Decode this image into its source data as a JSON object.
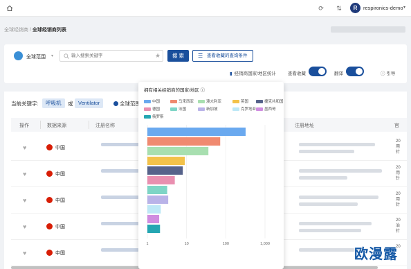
{
  "topbar": {
    "username": "respironics-demo",
    "avatar_letter": "R"
  },
  "breadcrumb": {
    "parent": "全球经销商",
    "separator": "/",
    "current": "全球经销商列表"
  },
  "search": {
    "scope_label": "全球范围",
    "placeholder": "输入搜索关键字",
    "search_button": "搜 索",
    "saved_button": "查看收藏的查询条件",
    "stats_link": "经销商国家/地区统计",
    "favorites_label": "查看收藏",
    "translate_label": "翻译",
    "guide_label": "引导"
  },
  "filters": {
    "prefix": "当前关键字:",
    "kw1": "呼吸机",
    "or": "或",
    "kw2": "Ventilator",
    "scope": "全球范围"
  },
  "table": {
    "columns": [
      "操作",
      "数据来源",
      "注册名称",
      "注册地址",
      "官"
    ],
    "rows": [
      {
        "country": "中国",
        "right": "20|用|针"
      },
      {
        "country": "中国",
        "right": "20|用|针"
      },
      {
        "country": "中国",
        "right": "20|用|针"
      },
      {
        "country": "中国",
        "right": "20|治|针"
      },
      {
        "country": "中国",
        "right": "20|"
      }
    ]
  },
  "chart_data": {
    "type": "bar",
    "orientation": "horizontal",
    "title": "拥有相关经销商的国家/地区",
    "x_scale": "log",
    "xlim": [
      1,
      1000
    ],
    "x_ticks": [
      "1",
      "10",
      "100",
      "1,000"
    ],
    "series": [
      {
        "name": "中国",
        "color": "#6aa9ef",
        "value": 320
      },
      {
        "name": "马来西亚",
        "color": "#f08a70",
        "value": 72
      },
      {
        "name": "澳大利亚",
        "color": "#a8dfb0",
        "value": 36
      },
      {
        "name": "英国",
        "color": "#f3c24a",
        "value": 9
      },
      {
        "name": "捷克共和国",
        "color": "#56628a",
        "value": 8
      },
      {
        "name": "德国",
        "color": "#e98fb0",
        "value": 5
      },
      {
        "name": "法国",
        "color": "#7ed5c6",
        "value": 3.2
      },
      {
        "name": "新加坡",
        "color": "#b9b3e8",
        "value": 3.4
      },
      {
        "name": "克罗地亚",
        "color": "#bde8f6",
        "value": 2.2
      },
      {
        "name": "墨西哥",
        "color": "#d08de0",
        "value": 2.0
      },
      {
        "name": "俄罗斯",
        "color": "#24a6b2",
        "value": 2.1
      }
    ]
  },
  "watermark": "欧漫露"
}
